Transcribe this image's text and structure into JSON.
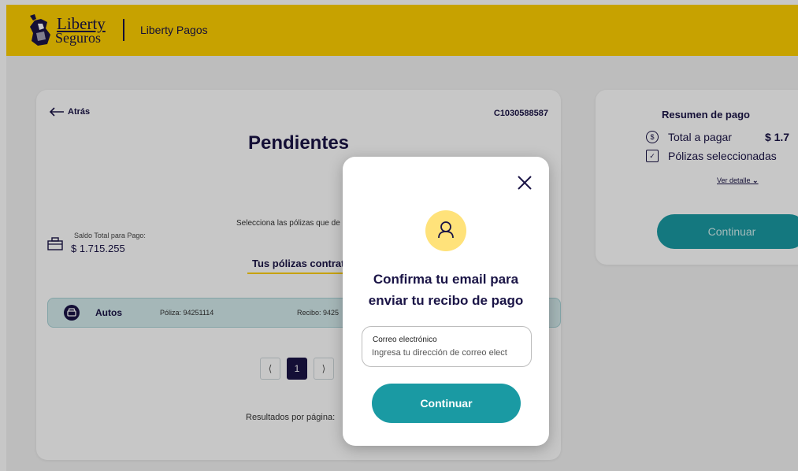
{
  "header": {
    "logo_line1": "Liberty",
    "logo_line2": "Seguros",
    "app_title": "Liberty Pagos"
  },
  "main": {
    "back_label": "Atrás",
    "client_id": "C1030588587",
    "title": "Pendientes",
    "subtitle": "Selecciona las pólizas que de",
    "saldo_label": "Saldo Total para Pago:",
    "saldo_value": "$ 1.715.255",
    "tab_label": "Tus pólizas contrat",
    "policy_row": {
      "type": "Autos",
      "poliza": "Póliza: 94251114",
      "recibo": "Recibo: 9425"
    },
    "pagination": {
      "prev": "⟨",
      "current": "1",
      "next": "⟩"
    },
    "results_label": "Resultados por página:"
  },
  "summary": {
    "title": "Resumen de pago",
    "total_label": "Total a pagar",
    "total_value": "$ 1.7",
    "selected_label": "Pólizas seleccionadas",
    "detail_link": "Ver detalle",
    "continue_label": "Continuar"
  },
  "modal": {
    "title_line1": "Confirma tu email para",
    "title_line2": "enviar tu recibo de pago",
    "email_label": "Correo electrónico",
    "email_placeholder": "Ingresa tu dirección de correo elect",
    "continue_label": "Continuar"
  },
  "colors": {
    "header": "#ffd000",
    "brand_navy": "#1a1446",
    "teal": "#1a9aa3",
    "avatar_bg": "#ffe27a"
  }
}
